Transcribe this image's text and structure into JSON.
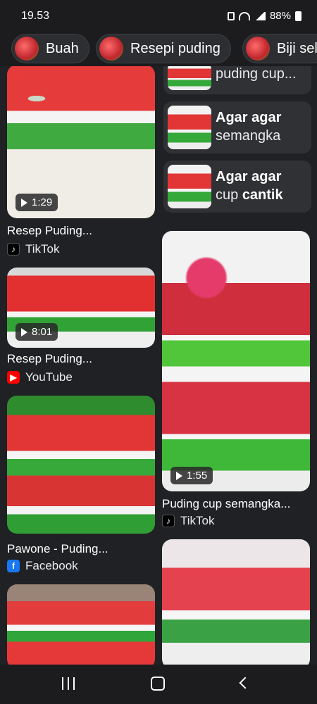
{
  "status": {
    "time": "19.53",
    "battery": "88%"
  },
  "chips": [
    {
      "label": "Buah"
    },
    {
      "label": "Resepi puding"
    },
    {
      "label": "Biji sel"
    }
  ],
  "related": [
    {
      "prefix": "",
      "line1": "puding cup...",
      "line2": ""
    },
    {
      "line1": "Agar agar",
      "line2": "semangka"
    },
    {
      "line1": "Agar agar",
      "line2a": "cup ",
      "line2b": "cantik"
    }
  ],
  "pins": [
    {
      "title": "Resep Puding...",
      "source": "TikTok",
      "duration": "1:29",
      "logo": "tiktok"
    },
    {
      "title": "Resep Puding...",
      "source": "YouTube",
      "duration": "8:01",
      "logo": "youtube"
    },
    {
      "title": "Pawone - Puding...",
      "source": "Facebook",
      "logo": "facebook"
    },
    {
      "title": "Puding cup semangka...",
      "source": "TikTok",
      "duration": "1:55",
      "logo": "tiktok"
    }
  ],
  "icons": {
    "tiktok": "♪",
    "youtube": "▶",
    "facebook": "f"
  }
}
